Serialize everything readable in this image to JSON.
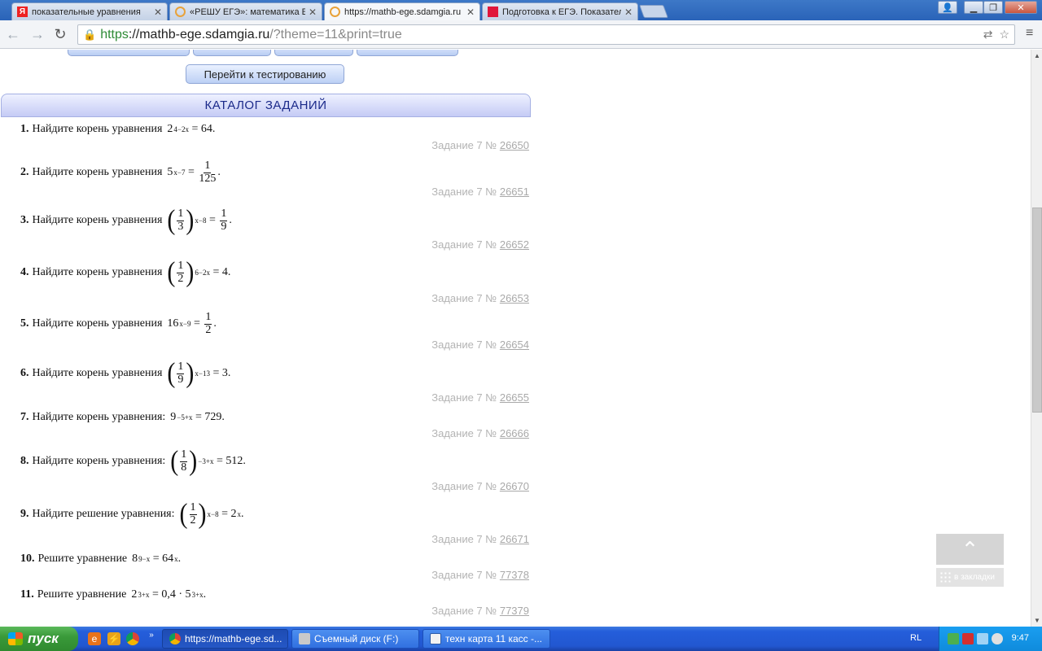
{
  "browser": {
    "tabs": [
      {
        "label": "показательные уравнения",
        "icon": "yandex-icon"
      },
      {
        "label": "«РЕШУ ЕГЭ»: математика ЕГЭ",
        "icon": "sdamgia-icon"
      },
      {
        "label": "https://mathb-ege.sdamgia.ru",
        "icon": "sdamgia-icon"
      },
      {
        "label": "Подготовка к ЕГЭ. Показательные",
        "icon": "red-square-icon"
      }
    ],
    "url": {
      "scheme": "https",
      "host": "://mathb-ege.sdamgia.ru",
      "path": "/?theme=11&print=true"
    }
  },
  "page": {
    "test_button": "Перейти к тестированию",
    "catalog_title": "КАТАЛОГ ЗАДАНИЙ",
    "ref_prefix": "Задание 7 №",
    "tasks": [
      {
        "num": "1.",
        "text": "Найдите корень уравнения",
        "id": "26650"
      },
      {
        "num": "2.",
        "text": "Найдите корень уравнения",
        "id": "26651"
      },
      {
        "num": "3.",
        "text": "Найдите корень уравнения",
        "id": "26652"
      },
      {
        "num": "4.",
        "text": "Найдите корень уравнения",
        "id": "26653"
      },
      {
        "num": "5.",
        "text": "Найдите корень уравнения",
        "id": "26654"
      },
      {
        "num": "6.",
        "text": "Найдите корень уравнения",
        "id": "26655"
      },
      {
        "num": "7.",
        "text": "Найдите корень уравнения:",
        "id": "26666"
      },
      {
        "num": "8.",
        "text": "Найдите корень уравнения:",
        "id": "26670"
      },
      {
        "num": "9.",
        "text": "Найдите решение уравнения:",
        "id": "26671"
      },
      {
        "num": "10.",
        "text": "Решите уравнение",
        "id": "77378"
      },
      {
        "num": "11.",
        "text": "Решите уравнение",
        "id": "77379"
      }
    ],
    "bookmarks_label": "в закладки"
  },
  "taskbar": {
    "start_label": "пуск",
    "tasks": [
      {
        "label": "https://mathb-ege.sd...",
        "active": true
      },
      {
        "label": "Съемный диск (F:)",
        "active": false
      },
      {
        "label": "техн карта 11 касс -...",
        "active": false
      }
    ],
    "lang": "RL",
    "clock": "9:47"
  }
}
